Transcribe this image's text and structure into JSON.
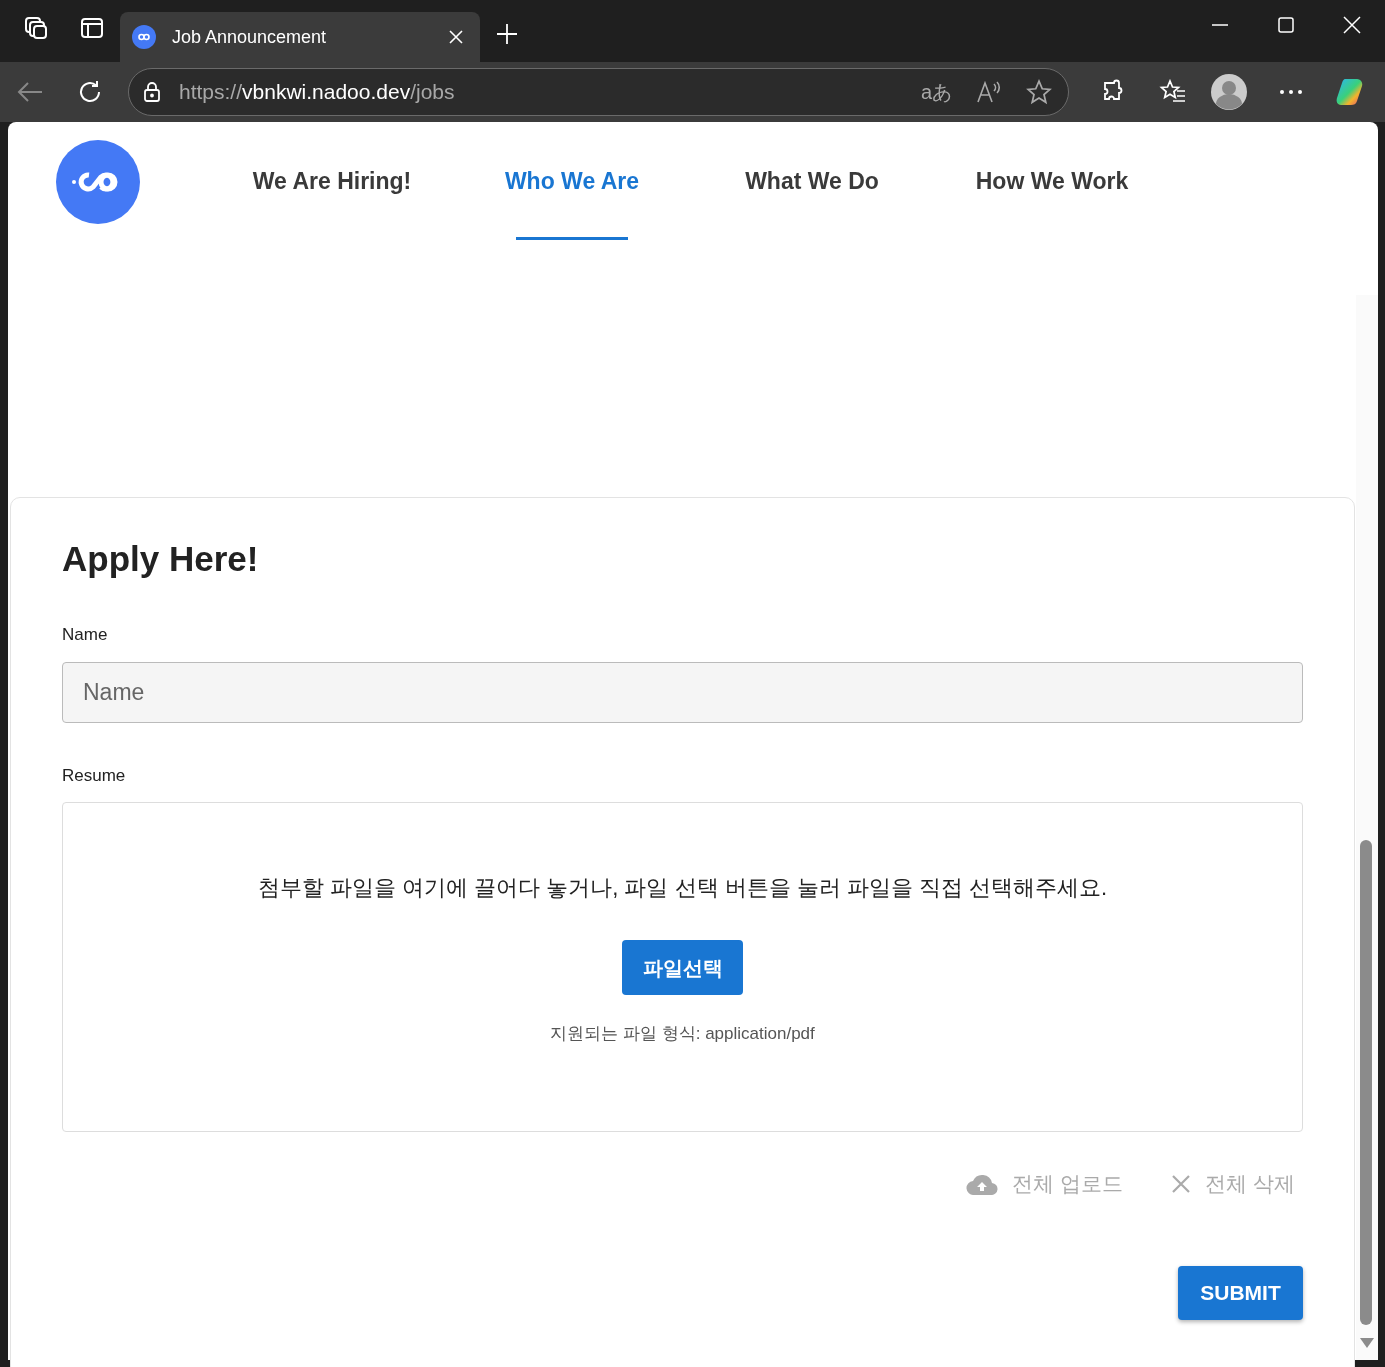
{
  "browser": {
    "tab_title": "Job Announcement",
    "url_scheme": "https://",
    "url_host": "vbnkwi.nadoo.dev",
    "url_path": "/jobs",
    "translate_glyph": "aあ"
  },
  "nav": [
    {
      "label": "We Are Hiring!",
      "selected": false
    },
    {
      "label": "Who We Are",
      "selected": true
    },
    {
      "label": "What We Do",
      "selected": false
    },
    {
      "label": "How We Work",
      "selected": false
    }
  ],
  "form": {
    "title": "Apply Here!",
    "name_label": "Name",
    "name_placeholder": "Name",
    "resume_label": "Resume",
    "dropzone_text": "첨부할 파일을 여기에 끌어다 놓거나, 파일 선택 버튼을 눌러 파일을 직접 선택해주세요.",
    "choose_button": "파일선택",
    "formats_text": "지원되는 파일 형식: application/pdf",
    "actions": [
      {
        "kind": "upload",
        "label": "전체 업로드",
        "disabled": true
      },
      {
        "kind": "delete",
        "label": "전체 삭제",
        "disabled": true
      }
    ],
    "submit": "SUBMIT"
  }
}
